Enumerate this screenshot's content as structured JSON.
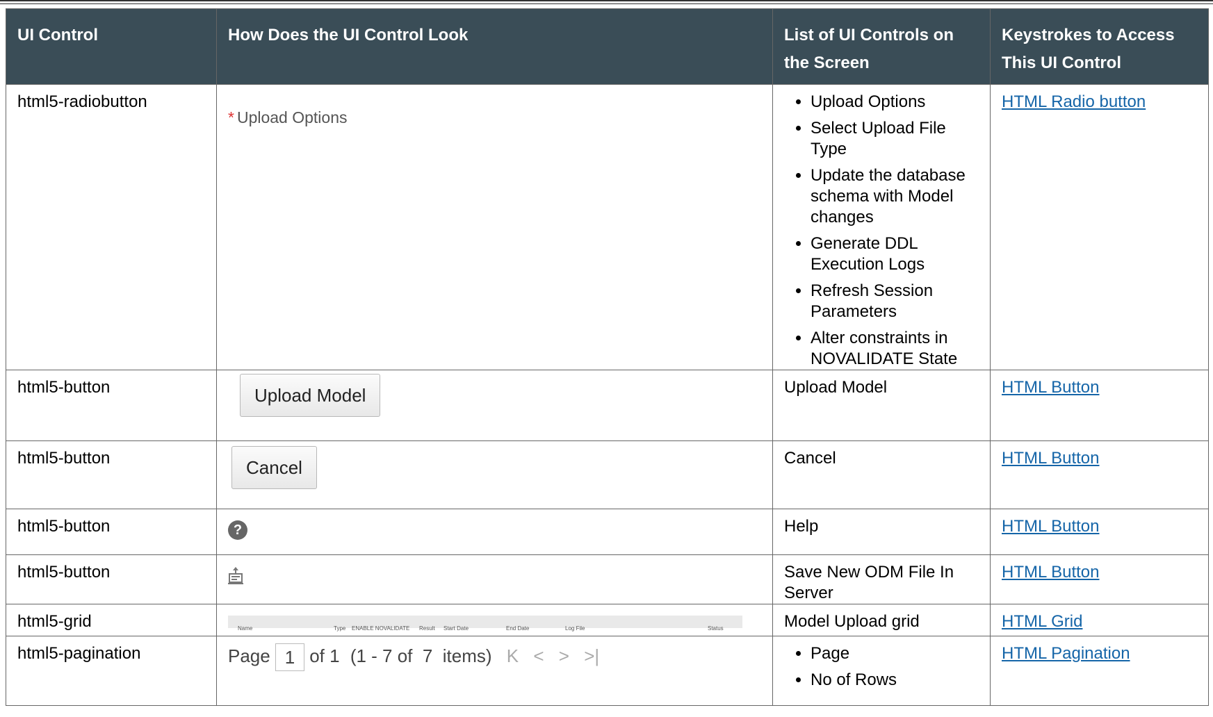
{
  "table": {
    "headers": [
      "UI Control",
      "How Does the UI Control Look",
      "List of UI Controls on the Screen",
      "Keystrokes to Access This UI Control"
    ],
    "rows": [
      {
        "control": "html5-radiobutton",
        "look_label": "Upload Options",
        "list": [
          "Upload Options",
          "Select Upload File Type",
          "Update the database schema with Model changes",
          "Generate DDL Execution Logs",
          "Refresh Session Parameters",
          "Alter constraints in NOVALIDATE State"
        ],
        "link": "HTML Radio button"
      },
      {
        "control": "html5-button",
        "look_button": "Upload Model",
        "list_text": "Upload Model",
        "link": "HTML Button"
      },
      {
        "control": "html5-button",
        "look_button": "Cancel",
        "list_text": "Cancel",
        "link": "HTML Button"
      },
      {
        "control": "html5-button",
        "look_icon": "help-icon",
        "list_text": "Help",
        "link": "HTML Button"
      },
      {
        "control": "html5-button",
        "look_icon": "save-to-server-icon",
        "list_text": "Save New ODM File In Server",
        "link": "HTML Button"
      },
      {
        "control": "html5-grid",
        "grid_columns": [
          "Name",
          "Type",
          "ENABLE NOVALIDATE",
          "Result",
          "Start Date",
          "End Date",
          "Log File",
          "Status"
        ],
        "list_text": "Model Upload grid",
        "link": "HTML Grid"
      },
      {
        "control": "html5-pagination",
        "pager": {
          "page_label": "Page",
          "page_value": "1",
          "of_text": "of 1",
          "range_text": "(1 - 7 of  7  items)"
        },
        "list": [
          "Page",
          "No of Rows"
        ],
        "link": "HTML Pagination"
      }
    ]
  },
  "colors": {
    "header_bg": "#3a4d57",
    "link": "#1565a8",
    "required_star": "#dd3333"
  }
}
